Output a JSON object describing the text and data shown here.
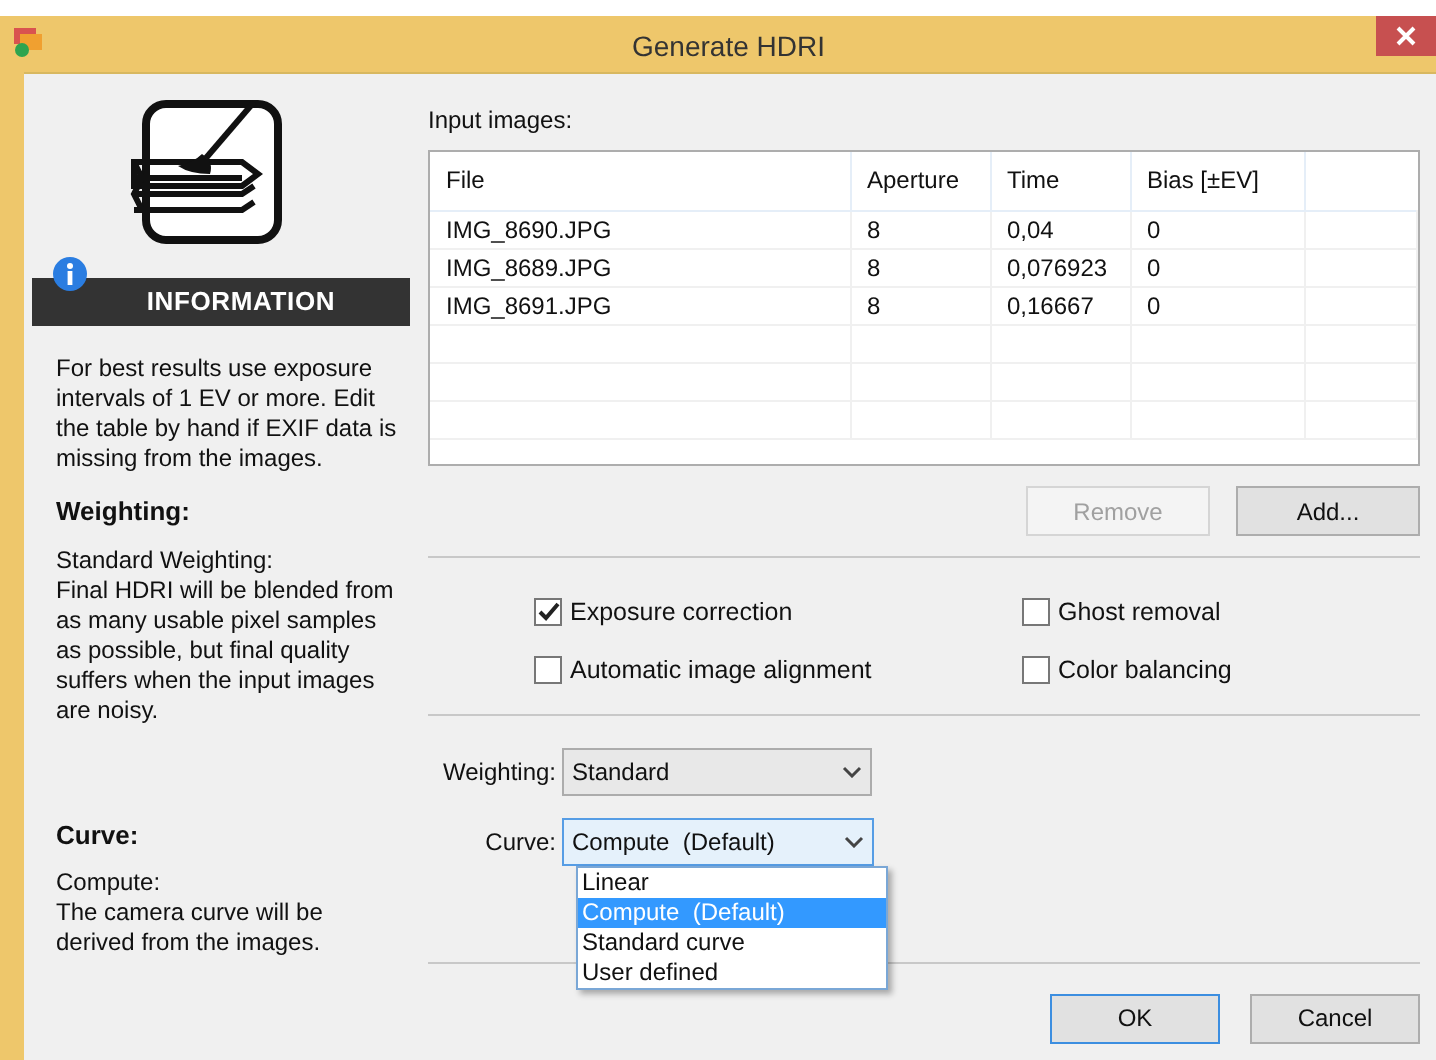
{
  "window": {
    "title": "Generate HDRI"
  },
  "info": {
    "heading": "INFORMATION",
    "intro": "For best results use exposure intervals of 1 EV or more. Edit the table by hand if EXIF data is missing from the images.",
    "sections": [
      {
        "title": "Weighting:",
        "lines": [
          "Standard Weighting:",
          "Final HDRI will be blended from as many usable pixel samples as possible, but final quality suffers when the input images are noisy."
        ]
      },
      {
        "title": "Curve:",
        "lines": [
          "Compute:",
          "The camera curve will be derived from the images."
        ]
      }
    ]
  },
  "input_images": {
    "label": "Input images:",
    "columns": [
      "File",
      "Aperture",
      "Time",
      "Bias [±EV]"
    ],
    "rows": [
      [
        "IMG_8690.JPG",
        "8",
        "0,04",
        "0"
      ],
      [
        "IMG_8689.JPG",
        "8",
        "0,076923",
        "0"
      ],
      [
        "IMG_8691.JPG",
        "8",
        "0,16667",
        "0"
      ]
    ],
    "buttons": [
      {
        "label": "Remove",
        "disabled": true
      },
      {
        "label": "Add...",
        "disabled": false
      }
    ]
  },
  "options": [
    {
      "label": "Exposure correction",
      "checked": true
    },
    {
      "label": "Ghost removal",
      "checked": false
    },
    {
      "label": "Automatic image alignment",
      "checked": false
    },
    {
      "label": "Color balancing",
      "checked": false
    }
  ],
  "weighting": {
    "label": "Weighting:",
    "value": "Standard"
  },
  "curve": {
    "label": "Curve:",
    "value": "Compute  (Default)",
    "expanded": true,
    "options": [
      {
        "label": "Linear",
        "selected": false
      },
      {
        "label": "Compute  (Default)",
        "selected": true
      },
      {
        "label": "Standard curve",
        "selected": false
      },
      {
        "label": "User defined",
        "selected": false
      }
    ]
  },
  "buttons": [
    {
      "label": "OK",
      "default": true
    },
    {
      "label": "Cancel",
      "default": false
    }
  ]
}
